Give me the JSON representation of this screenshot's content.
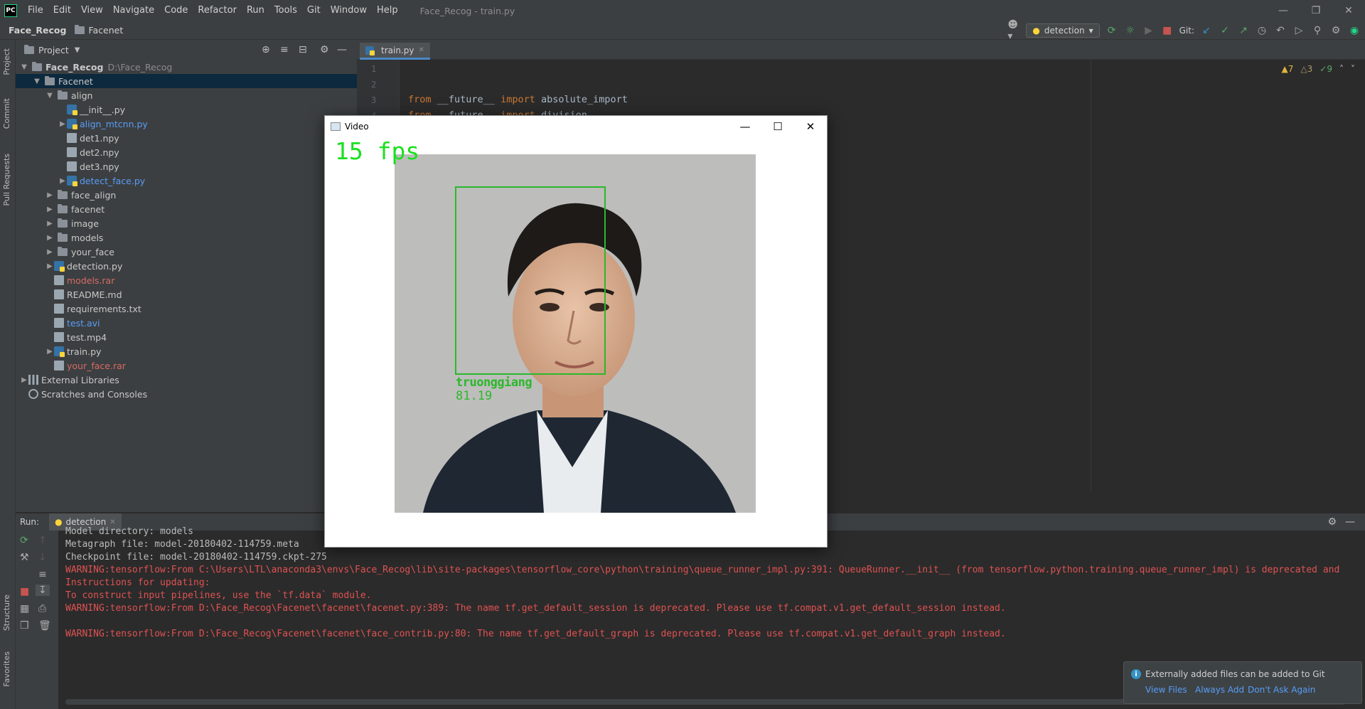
{
  "app": {
    "logo": "PC",
    "window_title": "Face_Recog - train.py",
    "menu": [
      "File",
      "Edit",
      "View",
      "Navigate",
      "Code",
      "Refactor",
      "Run",
      "Tools",
      "Git",
      "Window",
      "Help"
    ]
  },
  "navbar": {
    "project": "Face_Recog",
    "folder": "Facenet",
    "run_config": "detection",
    "git_label": "Git:"
  },
  "left_strip": {
    "project": "Project",
    "commit": "Commit",
    "pull_requests": "Pull Requests",
    "structure": "Structure",
    "favorites": "Favorites"
  },
  "project_panel": {
    "title": "Project",
    "root": "Face_Recog",
    "root_path": "D:\\Face_Recog",
    "tree": [
      {
        "label": "Facenet",
        "type": "folder",
        "level": 1,
        "expanded": true,
        "selected": true
      },
      {
        "label": "align",
        "type": "folder",
        "level": 2,
        "expanded": true
      },
      {
        "label": "__init__.py",
        "type": "py",
        "level": 3
      },
      {
        "label": "align_mtcnn.py",
        "type": "py",
        "level": 3,
        "color": "blue",
        "collapsed": true
      },
      {
        "label": "det1.npy",
        "type": "file",
        "level": 3
      },
      {
        "label": "det2.npy",
        "type": "file",
        "level": 3
      },
      {
        "label": "det3.npy",
        "type": "file",
        "level": 3
      },
      {
        "label": "detect_face.py",
        "type": "py",
        "level": 3,
        "color": "blue",
        "collapsed": true
      },
      {
        "label": "face_align",
        "type": "folder",
        "level": 2,
        "collapsed": true
      },
      {
        "label": "facenet",
        "type": "folder",
        "level": 2,
        "collapsed": true
      },
      {
        "label": "image",
        "type": "folder",
        "level": 2,
        "collapsed": true
      },
      {
        "label": "models",
        "type": "folder",
        "level": 2,
        "collapsed": true
      },
      {
        "label": "your_face",
        "type": "folder",
        "level": 2,
        "collapsed": true
      },
      {
        "label": "detection.py",
        "type": "py",
        "level": 2,
        "collapsed": true
      },
      {
        "label": "models.rar",
        "type": "file",
        "level": 2,
        "color": "red"
      },
      {
        "label": "README.md",
        "type": "file",
        "level": 2
      },
      {
        "label": "requirements.txt",
        "type": "file",
        "level": 2
      },
      {
        "label": "test.avi",
        "type": "file",
        "level": 2,
        "color": "blue"
      },
      {
        "label": "test.mp4",
        "type": "file",
        "level": 2
      },
      {
        "label": "train.py",
        "type": "py",
        "level": 2,
        "collapsed": true
      },
      {
        "label": "your_face.rar",
        "type": "file",
        "level": 2,
        "color": "red"
      },
      {
        "label": "External Libraries",
        "type": "lib",
        "level": 0,
        "collapsed": true
      },
      {
        "label": "Scratches and Consoles",
        "type": "scratch",
        "level": 0
      }
    ]
  },
  "editor": {
    "tab": "train.py",
    "line_numbers": [
      "1",
      "2",
      "3",
      "4"
    ],
    "lines": [
      {
        "keyword": "from",
        "rest": " __future__ ",
        "keyword2": "import",
        "rest2": " absolute_import"
      },
      {
        "keyword": "from",
        "rest": " __future__ ",
        "keyword2": "import",
        "rest2": " division"
      }
    ],
    "inspections": {
      "warnings": "7",
      "weak_warnings": "3",
      "ok": "9"
    }
  },
  "run_panel": {
    "label": "Run:",
    "tab": "detection",
    "console": [
      {
        "text": "Model directory: models",
        "err": false
      },
      {
        "text": "Metagraph file: model-20180402-114759.meta",
        "err": false
      },
      {
        "text": "Checkpoint file: model-20180402-114759.ckpt-275",
        "err": false
      },
      {
        "text": "WARNING:tensorflow:From C:\\Users\\LTL\\anaconda3\\envs\\Face_Recog\\lib\\site-packages\\tensorflow_core\\python\\training\\queue_runner_impl.py:391: QueueRunner.__init__ (from tensorflow.python.training.queue_runner_impl) is deprecated and",
        "err": true
      },
      {
        "text": "Instructions for updating:",
        "err": true
      },
      {
        "text": "To construct input pipelines, use the `tf.data` module.",
        "err": true
      },
      {
        "text": "WARNING:tensorflow:From D:\\Face_Recog\\Facenet\\facenet\\facenet.py:389: The name tf.get_default_session is deprecated. Please use tf.compat.v1.get_default_session instead.",
        "err": true
      },
      {
        "text": "",
        "err": false
      },
      {
        "text": "WARNING:tensorflow:From D:\\Face_Recog\\Facenet\\facenet\\face_contrib.py:80: The name tf.get_default_graph is deprecated. Please use tf.compat.v1.get_default_graph instead.",
        "err": true
      }
    ]
  },
  "notification": {
    "text": "Externally added files can be added to Git",
    "link_view": "View Files",
    "link_always": "Always Add",
    "link_dont": "Don't Ask Again"
  },
  "video_window": {
    "title": "Video",
    "fps": "15 fps",
    "name": "truonggiang",
    "score": "81.19"
  },
  "colors": {
    "accent": "#4a88c7",
    "error": "#e05252",
    "detection_box": "#2bb82b",
    "fps_text": "#19e01f"
  }
}
